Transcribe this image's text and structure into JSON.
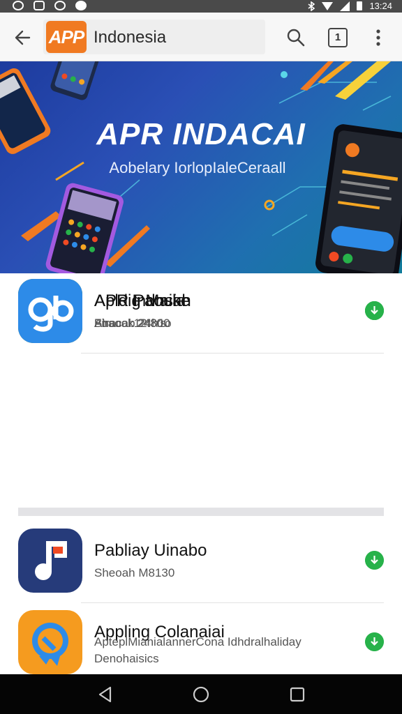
{
  "status_bar": {
    "time": "13:24",
    "icons": [
      "whatsapp-icon",
      "gallery-icon",
      "shield-icon",
      "notification-icon",
      "bluetooth-icon",
      "wifi-icon",
      "signal-icon",
      "battery-icon"
    ]
  },
  "app_bar": {
    "logo_text": "APP",
    "title": "Indonesia",
    "actions": [
      "search-icon",
      "tab-count-icon",
      "more-vert-icon"
    ],
    "tab_count": "1"
  },
  "banner": {
    "title": "APR INDACAI",
    "subtitle": "Aobelary IorlopIaleCeraall"
  },
  "apps": [
    {
      "name": "APP Indnsia",
      "meta": "Atracab 24h1o",
      "icon": "app-logo-orange-icon",
      "color": "#f04a23"
    },
    {
      "name": "APR Paouah",
      "meta": "Firaoal 12:300",
      "icon": "paper-plane-icon",
      "color": "#25b14a"
    },
    {
      "name": "Apldig Maike",
      "meta": "Bhsook 248ts",
      "icon": "gb-icon",
      "color": "#2d8be8"
    },
    {
      "name": "Pabliay Uinabo",
      "meta": "Sheoah M8130",
      "icon": "music-note-icon",
      "color": "#263b7a"
    },
    {
      "name": "Appling Colanaiai",
      "meta": "ApteplMiahialannerCona Idhdralhaliday",
      "meta2": "Denohaisics",
      "icon": "chat-bubble-icon",
      "color": "#f59b1f"
    }
  ],
  "colors": {
    "accent": "#f07a22",
    "download": "#27b24a",
    "nav_bar": "#050505"
  }
}
